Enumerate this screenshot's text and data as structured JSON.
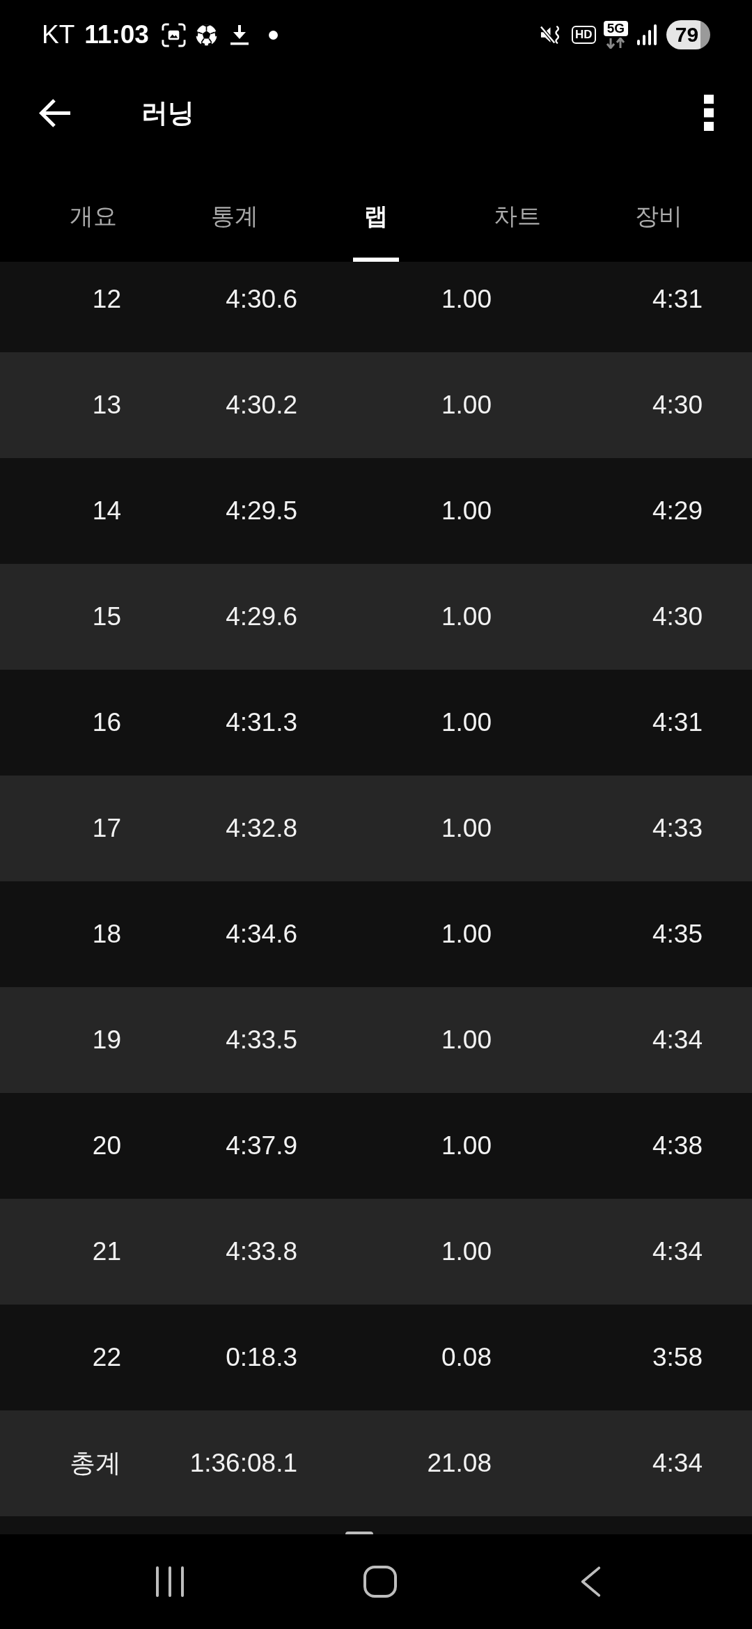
{
  "status_bar": {
    "carrier": "KT",
    "time": "11:03",
    "hd": "HD",
    "network": "5G",
    "battery": "79"
  },
  "app_bar": {
    "title": "러닝"
  },
  "tabs": [
    {
      "label": "개요",
      "selected": false
    },
    {
      "label": "통계",
      "selected": false
    },
    {
      "label": "랩",
      "selected": true
    },
    {
      "label": "차트",
      "selected": false
    },
    {
      "label": "장비",
      "selected": false
    }
  ],
  "laps": [
    {
      "lap": "12",
      "time": "4:30.6",
      "distance": "1.00",
      "pace": "4:31"
    },
    {
      "lap": "13",
      "time": "4:30.2",
      "distance": "1.00",
      "pace": "4:30"
    },
    {
      "lap": "14",
      "time": "4:29.5",
      "distance": "1.00",
      "pace": "4:29"
    },
    {
      "lap": "15",
      "time": "4:29.6",
      "distance": "1.00",
      "pace": "4:30"
    },
    {
      "lap": "16",
      "time": "4:31.3",
      "distance": "1.00",
      "pace": "4:31"
    },
    {
      "lap": "17",
      "time": "4:32.8",
      "distance": "1.00",
      "pace": "4:33"
    },
    {
      "lap": "18",
      "time": "4:34.6",
      "distance": "1.00",
      "pace": "4:35"
    },
    {
      "lap": "19",
      "time": "4:33.5",
      "distance": "1.00",
      "pace": "4:34"
    },
    {
      "lap": "20",
      "time": "4:37.9",
      "distance": "1.00",
      "pace": "4:38"
    },
    {
      "lap": "21",
      "time": "4:33.8",
      "distance": "1.00",
      "pace": "4:34"
    },
    {
      "lap": "22",
      "time": "0:18.3",
      "distance": "0.08",
      "pace": "3:58"
    }
  ],
  "total": {
    "label": "총계",
    "time": "1:36:08.1",
    "distance": "21.08",
    "pace": "4:34"
  }
}
